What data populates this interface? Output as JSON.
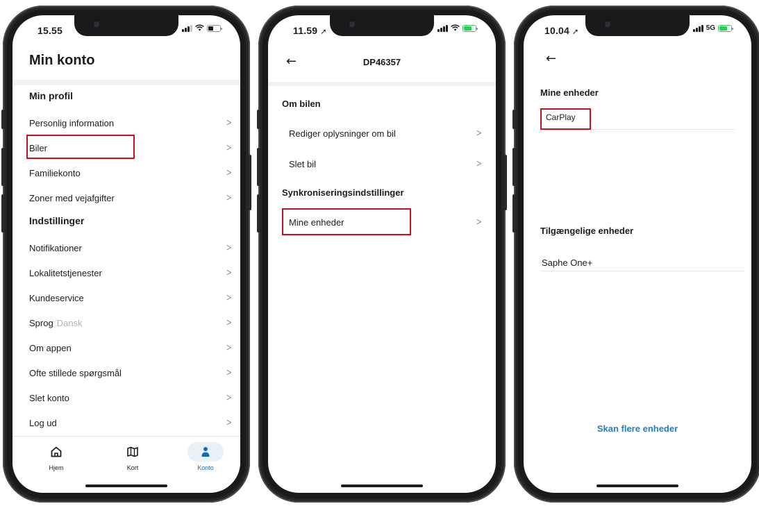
{
  "screens": [
    {
      "status": {
        "time": "15.55"
      },
      "title": "Min konto",
      "profile_heading": "Min profil",
      "profile_items": [
        {
          "label": "Personlig information"
        },
        {
          "label": "Biler"
        },
        {
          "label": "Familiekonto"
        },
        {
          "label": "Zoner med vejafgifter"
        }
      ],
      "settings_heading": "Indstillinger",
      "settings_items": [
        {
          "label": "Notifikationer"
        },
        {
          "label": "Lokalitetstjenester"
        },
        {
          "label": "Kundeservice"
        },
        {
          "label": "Sprog",
          "value": "Dansk"
        },
        {
          "label": "Om appen"
        },
        {
          "label": "Ofte stillede spørgsmål"
        },
        {
          "label": "Slet konto"
        },
        {
          "label": "Log ud"
        }
      ],
      "tabs": [
        {
          "label": "Hjem",
          "icon": "home-icon"
        },
        {
          "label": "Kort",
          "icon": "map-icon"
        },
        {
          "label": "Konto",
          "icon": "person-icon",
          "active": true
        }
      ],
      "highlighted_item": "Biler"
    },
    {
      "status": {
        "time": "11.59"
      },
      "nav_title": "DP46357",
      "car_heading": "Om bilen",
      "car_items": [
        {
          "label": "Rediger oplysninger om bil"
        },
        {
          "label": "Slet bil"
        }
      ],
      "sync_heading": "Synkroniseringsindstillinger",
      "sync_items": [
        {
          "label": "Mine enheder"
        }
      ],
      "highlighted_item": "Mine enheder"
    },
    {
      "status": {
        "time": "10.04",
        "network": "5G"
      },
      "my_devices_heading": "Mine enheder",
      "my_devices": [
        {
          "name": "CarPlay"
        }
      ],
      "available_heading": "Tilgængelige enheder",
      "available_devices": [
        {
          "name": "Saphe One+"
        }
      ],
      "scan_button": "Skan flere enheder",
      "highlighted_item": "CarPlay"
    }
  ],
  "colors": {
    "accent_blue": "#0d6fb5",
    "link_blue": "#1e7fc1",
    "highlight_red": "#c1121f",
    "charging_green": "#34c759"
  }
}
